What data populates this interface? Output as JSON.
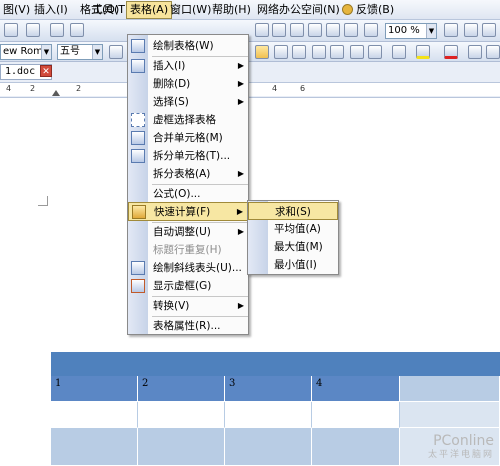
{
  "menubar": {
    "items": [
      {
        "label": "图(V)"
      },
      {
        "label": "插入(I)"
      },
      {
        "label": "格式(O)"
      },
      {
        "label": "工具(T)"
      },
      {
        "label": "表格(A)"
      },
      {
        "label": "窗口(W)"
      },
      {
        "label": "帮助(H)"
      },
      {
        "label": "网络办公空间(N)"
      },
      {
        "label": "反馈(B)"
      }
    ]
  },
  "toolbar": {
    "font_name": "ew Roman",
    "font_size": "五号",
    "zoom": "100 %"
  },
  "document_tab": {
    "filename": "1.doc *"
  },
  "ruler": {
    "numbers": [
      "4",
      "2",
      "2",
      "4",
      "6"
    ]
  },
  "table_menu": {
    "items": [
      {
        "label": "绘制表格(W)",
        "icon": "pencil-icon",
        "submenu": false,
        "disabled": false
      },
      {
        "label": "插入(I)",
        "icon": "table-icon",
        "submenu": true,
        "disabled": false
      },
      {
        "label": "删除(D)",
        "icon": "",
        "submenu": true,
        "disabled": false
      },
      {
        "label": "选择(S)",
        "icon": "",
        "submenu": true,
        "disabled": false
      },
      {
        "label": "虚框选择表格",
        "icon": "select-table-icon",
        "submenu": false,
        "disabled": false
      },
      {
        "label": "合并单元格(M)",
        "icon": "merge-cells-icon",
        "submenu": false,
        "disabled": false
      },
      {
        "label": "拆分单元格(T)...",
        "icon": "split-cells-icon",
        "submenu": false,
        "disabled": false
      },
      {
        "label": "拆分表格(A)",
        "icon": "",
        "submenu": true,
        "disabled": false
      },
      {
        "label": "公式(O)...",
        "icon": "",
        "submenu": false,
        "disabled": false
      },
      {
        "label": "快速计算(F)",
        "icon": "calculator-icon",
        "submenu": true,
        "disabled": false,
        "highlighted": true
      },
      {
        "label": "自动调整(U)",
        "icon": "",
        "submenu": true,
        "disabled": false
      },
      {
        "label": "标题行重复(H)",
        "icon": "",
        "submenu": false,
        "disabled": true
      },
      {
        "label": "绘制斜线表头(U)...",
        "icon": "diagonal-header-icon",
        "submenu": false,
        "disabled": false
      },
      {
        "label": "显示虚框(G)",
        "icon": "gridlines-icon",
        "submenu": false,
        "disabled": false
      },
      {
        "label": "转换(V)",
        "icon": "",
        "submenu": true,
        "disabled": false
      },
      {
        "label": "表格属性(R)...",
        "icon": "",
        "submenu": false,
        "disabled": false
      }
    ]
  },
  "quick_calc_menu": {
    "items": [
      {
        "label": "求和(S)",
        "highlighted": true
      },
      {
        "label": "平均值(A)"
      },
      {
        "label": "最大值(M)"
      },
      {
        "label": "最小值(I)"
      }
    ]
  },
  "table": {
    "row1": [
      "1",
      "2",
      "3",
      "4",
      ""
    ],
    "colors": {
      "header": "#4f81bd",
      "dark": "#5b87c5",
      "light": "#b8cce4",
      "lighter": "#dbe5f1"
    }
  },
  "watermark": {
    "brand": "PConline",
    "sub": "太平洋电脑网"
  }
}
